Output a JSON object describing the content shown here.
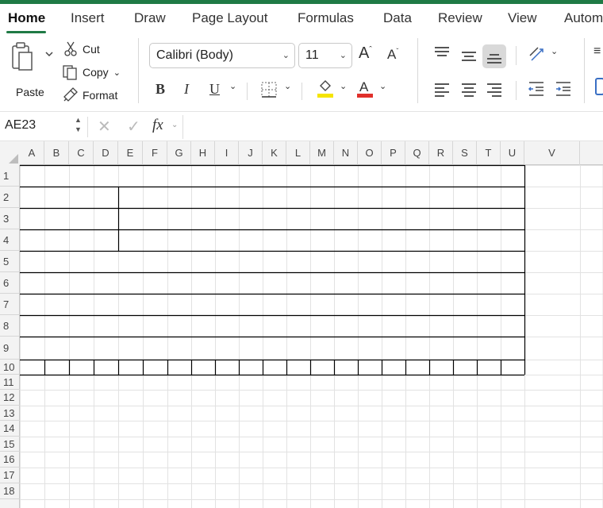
{
  "tabs": [
    "Home",
    "Insert",
    "Draw",
    "Page Layout",
    "Formulas",
    "Data",
    "Review",
    "View",
    "Autom"
  ],
  "clipboard": {
    "paste": "Paste",
    "cut": "Cut",
    "copy": "Copy",
    "format": "Format"
  },
  "font": {
    "family": "Calibri (Body)",
    "size": "11"
  },
  "format_buttons": {
    "bold": "B",
    "italic": "I",
    "underline": "U"
  },
  "colors": {
    "accent": "#1f7a45",
    "highlight": "#f5e400",
    "font_color": "#e0302b",
    "border": "#000000"
  },
  "formula_bar": {
    "name_box": "AE23",
    "fx": "fx",
    "value": ""
  },
  "sheet": {
    "columns": [
      "A",
      "B",
      "C",
      "D",
      "E",
      "F",
      "G",
      "H",
      "I",
      "J",
      "K",
      "L",
      "M",
      "N",
      "O",
      "P",
      "Q",
      "R",
      "S",
      "T",
      "U",
      "V"
    ],
    "rows": [
      "1",
      "2",
      "3",
      "4",
      "5",
      "6",
      "7",
      "8",
      "9",
      "10",
      "11",
      "12",
      "13",
      "14",
      "15",
      "16",
      "17",
      "18"
    ]
  }
}
